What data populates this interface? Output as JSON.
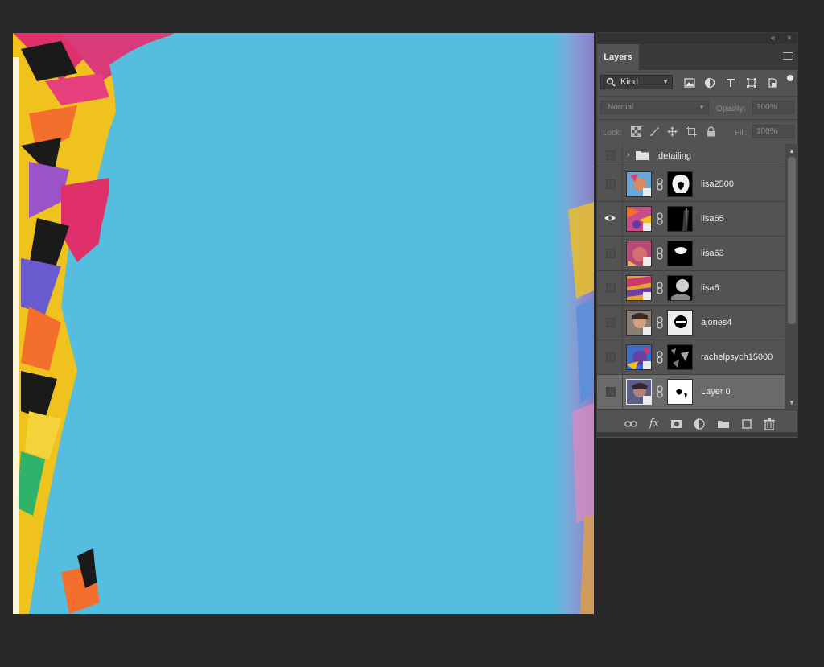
{
  "panel": {
    "tab_label": "Layers",
    "collapse_glyph": "«",
    "close_glyph": "×",
    "menu_icon": "panel-menu-icon",
    "filter": {
      "kind_label": "Kind",
      "icons": [
        "image-filter-icon",
        "adjustment-filter-icon",
        "type-filter-icon",
        "shape-filter-icon",
        "smart-object-filter-icon"
      ],
      "filter_toggle_on": true
    },
    "blend_mode": "Normal",
    "opacity_label": "Opacity:",
    "opacity_value": "100%",
    "lock_label": "Lock:",
    "lock_icons": [
      "lock-transparent-pixels-icon",
      "lock-image-pixels-icon",
      "lock-position-icon",
      "lock-artboard-icon",
      "lock-all-icon"
    ],
    "fill_label": "Fill:",
    "fill_value": "100%"
  },
  "layers": [
    {
      "name": "detailing",
      "type": "group",
      "visible": false,
      "expanded": false
    },
    {
      "name": "lisa2500",
      "type": "smart",
      "visible": false
    },
    {
      "name": "lisa65",
      "type": "smart",
      "visible": true
    },
    {
      "name": "lisa63",
      "type": "smart",
      "visible": false
    },
    {
      "name": "lisa6",
      "type": "smart",
      "visible": false
    },
    {
      "name": "ajones4",
      "type": "smart",
      "visible": false
    },
    {
      "name": "rachelpsych15000",
      "type": "smart",
      "visible": false
    },
    {
      "name": "Layer 0",
      "type": "smart",
      "visible": false,
      "selected": true
    }
  ],
  "footer_icons": [
    "link-layers-icon",
    "layer-style-fx-icon",
    "add-mask-icon",
    "adjustment-layer-icon",
    "new-group-icon",
    "new-layer-icon",
    "delete-layer-icon"
  ],
  "footer_fx_label": "fx",
  "colors": {
    "canvas_cyan": "#55bedf",
    "panel_bg": "#535353",
    "app_bg": "#282828",
    "selected_row": "#6a6a6a"
  }
}
